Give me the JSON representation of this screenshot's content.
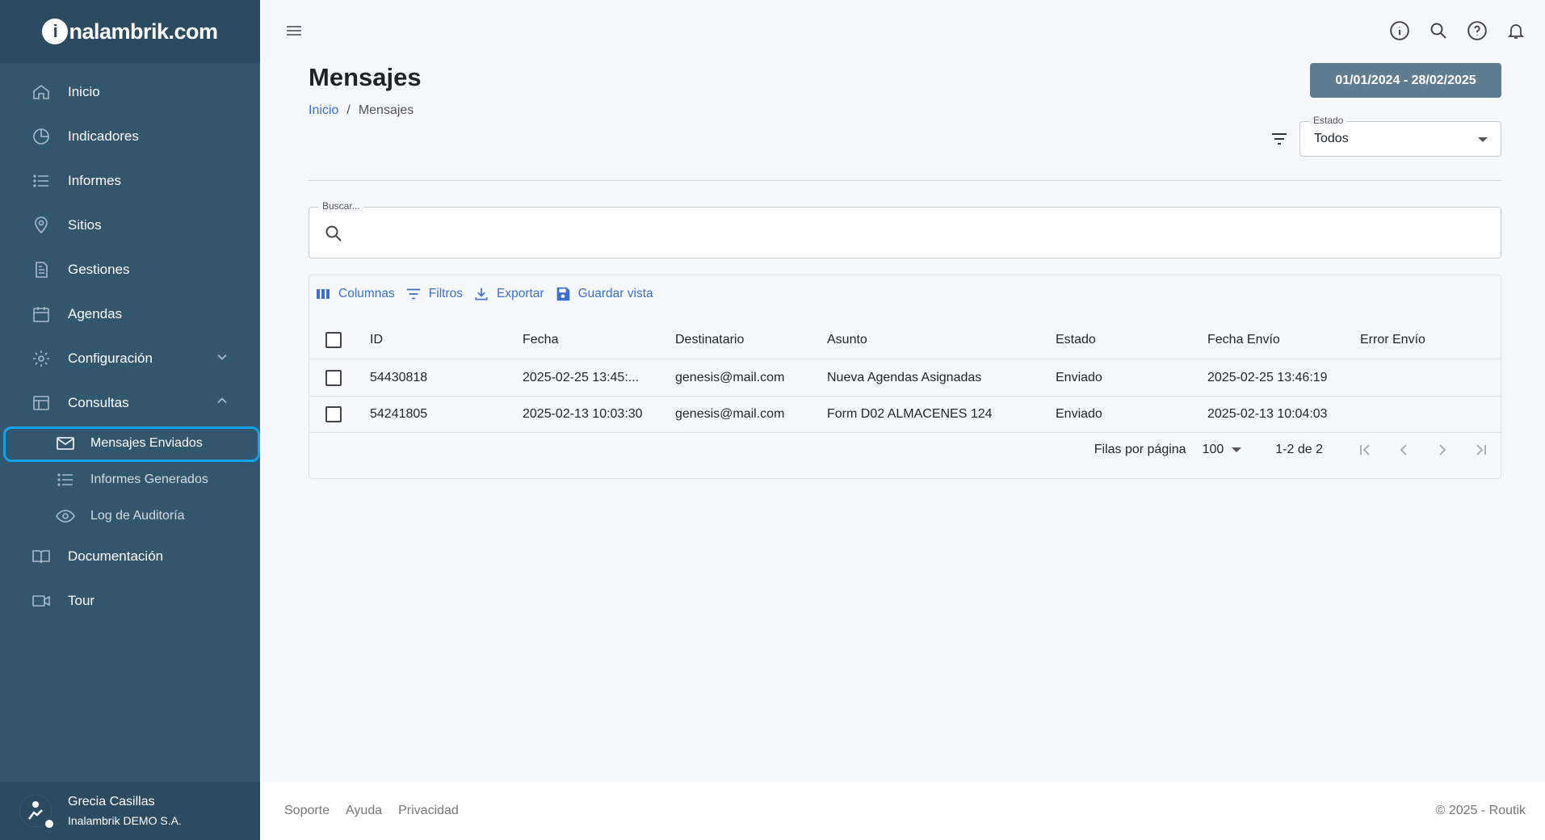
{
  "brand": {
    "logo_letter": "i",
    "logo_rest": "nalambrik.com"
  },
  "sidebar": {
    "items": [
      {
        "label": "Inicio",
        "icon": "home-icon"
      },
      {
        "label": "Indicadores",
        "icon": "pie-chart-icon"
      },
      {
        "label": "Informes",
        "icon": "list-icon"
      },
      {
        "label": "Sitios",
        "icon": "location-pin-icon"
      },
      {
        "label": "Gestiones",
        "icon": "document-icon"
      },
      {
        "label": "Agendas",
        "icon": "calendar-icon"
      },
      {
        "label": "Configuración",
        "icon": "gear-icon",
        "expanded": false
      },
      {
        "label": "Consultas",
        "icon": "table-icon",
        "expanded": true
      }
    ],
    "sub_items": [
      {
        "label": "Mensajes Enviados",
        "icon": "mail-icon",
        "active": true
      },
      {
        "label": "Informes Generados",
        "icon": "list-icon",
        "active": false
      },
      {
        "label": "Log de Auditoría",
        "icon": "eye-icon",
        "active": false
      }
    ],
    "bottom_items": [
      {
        "label": "Documentación",
        "icon": "book-icon"
      },
      {
        "label": "Tour",
        "icon": "video-icon"
      }
    ],
    "user": {
      "name": "Grecia Casillas",
      "org": "Inalambrik DEMO S.A."
    }
  },
  "header": {
    "title": "Mensajes",
    "breadcrumb": {
      "home": "Inicio",
      "current": "Mensajes",
      "separator": "/"
    },
    "date_range": "01/01/2024 - 28/02/2025",
    "estado": {
      "label": "Estado",
      "value": "Todos"
    }
  },
  "search": {
    "label": "Buscar..."
  },
  "toolbar": {
    "columns": "Columnas",
    "filters": "Filtros",
    "export": "Exportar",
    "save_view": "Guardar vista"
  },
  "table": {
    "headers": [
      "ID",
      "Fecha",
      "Destinatario",
      "Asunto",
      "Estado",
      "Fecha Envío",
      "Error Envío"
    ],
    "rows": [
      [
        "54430818",
        "2025-02-25 13:45:...",
        "genesis@mail.com",
        "Nueva Agendas Asignadas",
        "Enviado",
        "2025-02-25 13:46:19",
        ""
      ],
      [
        "54241805",
        "2025-02-13 10:03:30",
        "genesis@mail.com",
        "Form D02 ALMACENES 124",
        "Enviado",
        "2025-02-13 10:04:03",
        ""
      ]
    ]
  },
  "pagination": {
    "rows_label": "Filas por página",
    "rows_value": "100",
    "range": "1-2 de 2"
  },
  "footer": {
    "links": [
      "Soporte",
      "Ayuda",
      "Privacidad"
    ],
    "copyright": "© 2025 - Routik"
  },
  "colors": {
    "sidebar": "#33566f",
    "sidebar_dark": "#2b4b62",
    "accent": "#3b6fd4",
    "active_outline": "#16a3e9",
    "date_button": "#607d8f"
  }
}
